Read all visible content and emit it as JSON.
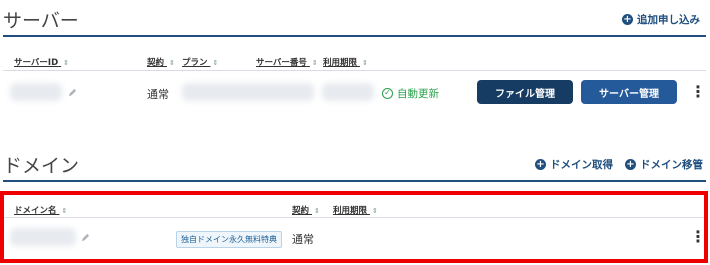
{
  "server": {
    "title": "サーバー",
    "add_link": "追加申し込み",
    "columns": {
      "id": "サーバーID",
      "contract": "契約",
      "plan": "プラン",
      "server_no": "サーバー番号",
      "expiry": "利用期限"
    },
    "row": {
      "contract": "通常",
      "auto_renew": "自動更新",
      "file_button": "ファイル管理",
      "server_button": "サーバー管理"
    }
  },
  "domain": {
    "title": "ドメイン",
    "get_link": "ドメイン取得",
    "transfer_link": "ドメイン移管",
    "columns": {
      "name": "ドメイン名",
      "contract": "契約",
      "expiry": "利用期限"
    },
    "row": {
      "badge": "独自ドメイン永久無料特典",
      "contract": "通常"
    }
  },
  "colors": {
    "accent": "#1f4e7f",
    "highlight": "#ee0000",
    "renew_green": "#2aa04a"
  },
  "icons": {
    "sort": "⇕",
    "more": "⋮"
  }
}
